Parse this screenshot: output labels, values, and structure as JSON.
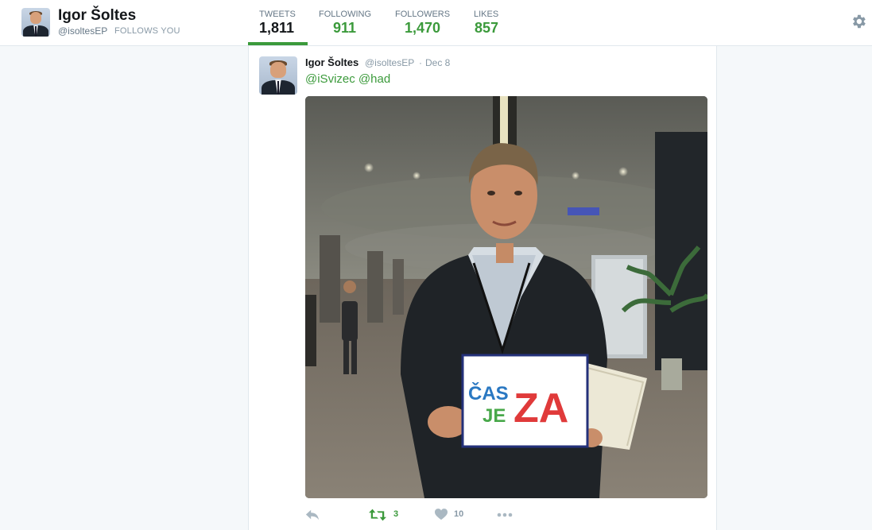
{
  "profile": {
    "name": "Igor Šoltes",
    "handle": "@isoltesEP",
    "follows_you": "FOLLOWS YOU"
  },
  "stats": [
    {
      "label": "TWEETS",
      "value": "1,811",
      "active": true
    },
    {
      "label": "FOLLOWING",
      "value": "911",
      "active": false
    },
    {
      "label": "FOLLOWERS",
      "value": "1,470",
      "active": false
    },
    {
      "label": "LIKES",
      "value": "857",
      "active": false
    }
  ],
  "tweet": {
    "author": "Igor Šoltes",
    "handle": "@isoltesEP",
    "separator": "·",
    "time": "Dec 8",
    "mentions": [
      "@iSvizec",
      "@had"
    ],
    "photo_sign_text": {
      "line1": "ČAS",
      "line2": "JE",
      "big": "ZA"
    },
    "actions": {
      "reply_icon": "reply-icon",
      "retweet_icon": "retweet-icon",
      "retweet_count": "3",
      "like_icon": "heart-icon",
      "like_count": "10",
      "more_icon": "more-dots-icon"
    }
  },
  "colors": {
    "accent": "#3b9a3b",
    "muted": "#8899a6",
    "background": "#f5f8fa"
  }
}
